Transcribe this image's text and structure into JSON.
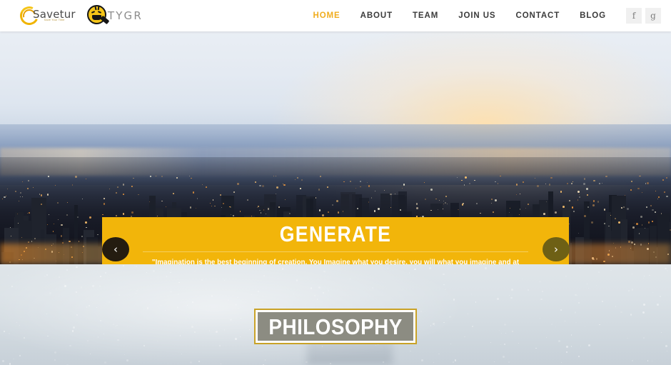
{
  "header": {
    "logos": [
      {
        "name": "Savetur",
        "wordmark": "Savetur",
        "tagline": "Save Your Time"
      },
      {
        "name": "TYGR",
        "wordmark": "TYGR"
      }
    ],
    "nav": [
      {
        "label": "HOME",
        "active": true
      },
      {
        "label": "ABOUT",
        "active": false
      },
      {
        "label": "TEAM",
        "active": false
      },
      {
        "label": "JOIN US",
        "active": false
      },
      {
        "label": "CONTACT",
        "active": false
      },
      {
        "label": "BLOG",
        "active": false
      }
    ],
    "social": [
      {
        "icon": "facebook-icon",
        "glyph": "f"
      },
      {
        "icon": "google-plus-icon",
        "glyph": "g"
      }
    ]
  },
  "hero": {
    "image_description": "Aerial view of Hong Kong Victoria Harbour at dusk with hazy sunset sky",
    "banner": {
      "title": "GENERATE",
      "quote": "\"Imagination is the best beginning of creation. You Imagine what you desire, you will what you imagine and at last you create what you will\"- George Bernard Shaw",
      "prev_glyph": "‹",
      "next_glyph": "›",
      "background_color": "#f2b50a",
      "title_color": "#ffffff"
    }
  },
  "philosophy": {
    "heading": "PHILOSOPHY",
    "box_fill": "#8c8c82",
    "box_border": "#c9a227"
  },
  "colors": {
    "accent_yellow": "#f2b50a",
    "nav_active": "#f0ad1f",
    "nav_default": "#3b3b3b",
    "header_bg": "#ffffff"
  }
}
